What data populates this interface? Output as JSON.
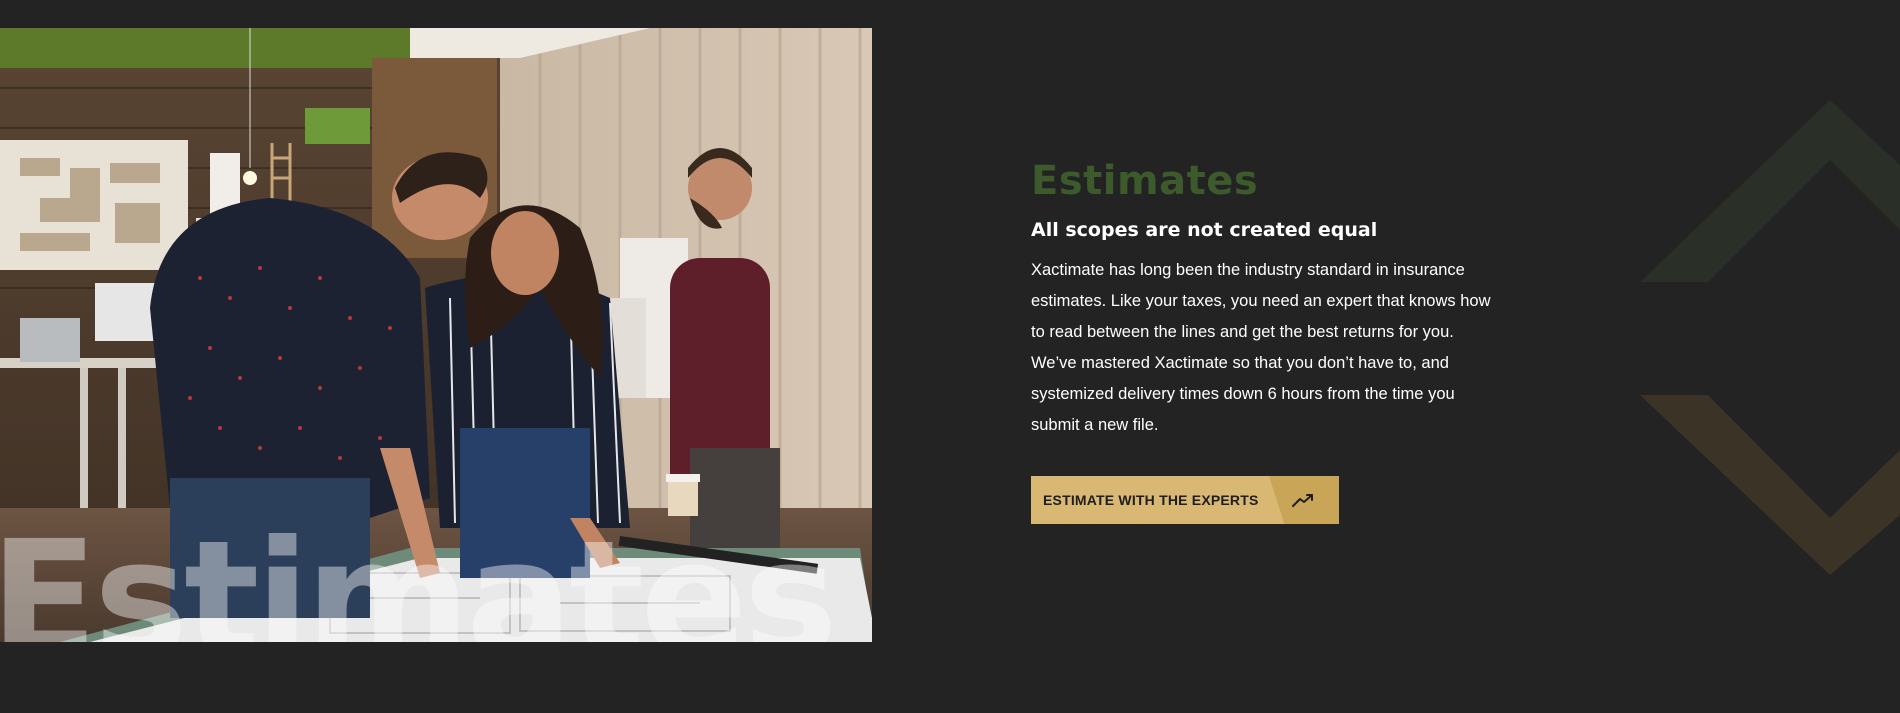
{
  "hero": {
    "watermark_text": "Estimates"
  },
  "content": {
    "title": "Estimates",
    "subtitle": "All scopes are not created equal",
    "body": "Xactimate has long been the industry standard in insurance estimates. Like your taxes, you need an expert that knows how to read between the lines and get the best returns for you. We’ve mastered Xactimate so that you don’t have to, and systemized delivery times down 6 hours from the time you submit a new file.",
    "cta_label": "ESTIMATE WITH THE EXPERTS",
    "cta_icon": "trending-arrow-icon"
  },
  "colors": {
    "background": "#232323",
    "title_green": "#3c5a2c",
    "cta_gold": "#d9b873",
    "decor_green": "#2a2f27",
    "decor_gold": "#3b3325"
  }
}
